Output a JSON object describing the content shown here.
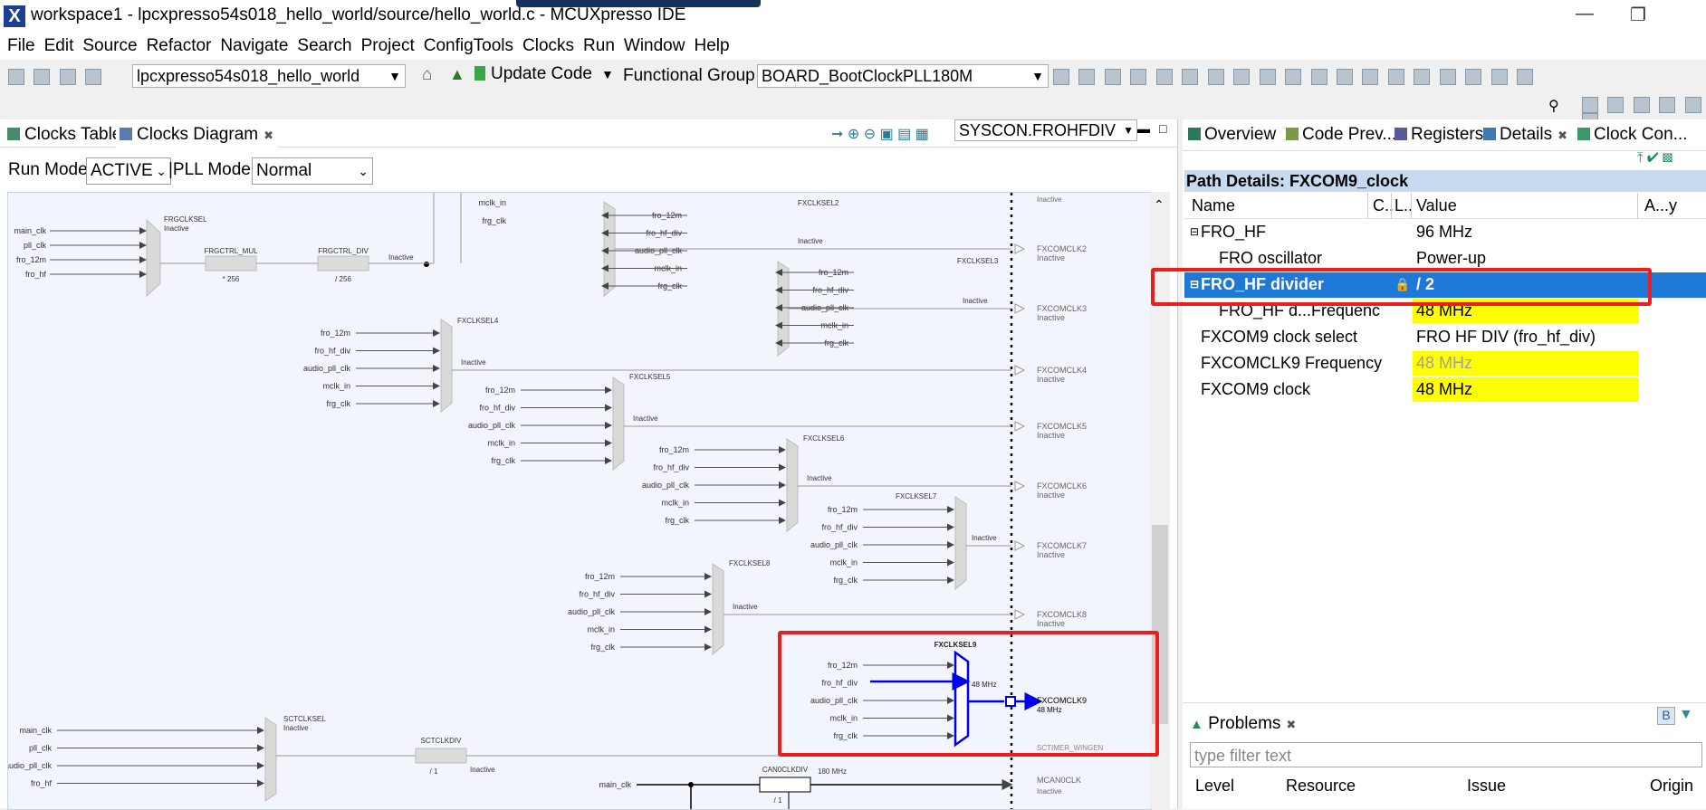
{
  "window": {
    "title": "workspace1 - lpcxpresso54s018_hello_world/source/hello_world.c - MCUXpresso IDE",
    "app_icon": "X"
  },
  "menu": [
    "File",
    "Edit",
    "Source",
    "Refactor",
    "Navigate",
    "Search",
    "Project",
    "ConfigTools",
    "Clocks",
    "Run",
    "Window",
    "Help"
  ],
  "toolbar": {
    "project": "lpcxpresso54s018_hello_world",
    "update_code": "Update Code",
    "functional_group_label": "Functional Group",
    "functional_group_value": "BOARD_BootClockPLL180M"
  },
  "left_tabs": {
    "clocks_table": "Clocks Table",
    "clocks_diagram": "Clocks Diagram",
    "search_value": "SYSCON.FROHFDIV"
  },
  "mode": {
    "run_mode_label": "Run Mode",
    "run_mode_value": "ACTIVE",
    "pll_mode_label": "|PLL Mode",
    "pll_mode_value": "Normal"
  },
  "diagram": {
    "inactive": "Inactive",
    "frgclksel": "FRGCLKSEL",
    "frgctrl_mul": "FRGCTRL_MUL",
    "frgctrl_div": "FRGCTRL_DIV",
    "mul_val": "* 256",
    "div_val": "/ 256",
    "frg_inputs": [
      "main_clk",
      "pll_clk",
      "fro_12m",
      "fro_hf"
    ],
    "fx_inputs": [
      "fro_12m",
      "fro_hf_div",
      "audio_pll_clk",
      "mclk_in",
      "frg_clk"
    ],
    "top_inputs": [
      "mclk_in",
      "frg_clk"
    ],
    "fxclksel": [
      "FXCLKSEL2",
      "FXCLKSEL3",
      "FXCLKSEL4",
      "FXCLKSEL5",
      "FXCLKSEL6",
      "FXCLKSEL7",
      "FXCLKSEL8"
    ],
    "fxcomclk": [
      "FXCOMCLK2",
      "FXCOMCLK3",
      "FXCOMCLK4",
      "FXCOMCLK5",
      "FXCOMCLK6",
      "FXCOMCLK7",
      "FXCOMCLK8"
    ],
    "sel9": "FXCLKSEL9",
    "sel9_freq": "48 MHz",
    "com9": "FXCOMCLK9",
    "com9_freq": "48 MHz",
    "sctclksel": "SCTCLKSEL",
    "sct_inputs": [
      "main_clk",
      "pll_clk",
      "audio_pll_clk",
      "fro_hf"
    ],
    "sctclkdiv": "SCTCLKDIV",
    "sct_div": "/ 1",
    "can0clkdiv": "CAN0CLKDIV",
    "can_freq": "180 MHz",
    "can_div": "/ 1",
    "can_in": "main_clk",
    "mcan0clk": "MCAN0CLK",
    "sctimer": "SCTIMER_WINGEN"
  },
  "right_tabs": [
    "Overview",
    "Code Prev...",
    "Registers",
    "Details",
    "Clock Con..."
  ],
  "details": {
    "path_header": "Path Details: FXCOM9_clock",
    "columns": [
      "Name",
      "C..",
      "L..",
      "Value",
      "A...y"
    ],
    "rows": [
      {
        "name": "FRO_HF",
        "value": "96 MHz",
        "style": "normal",
        "expand": "⊟"
      },
      {
        "name": "FRO oscillator",
        "value": "Power-up",
        "style": "normal",
        "expand": ""
      },
      {
        "name": "FRO_HF divider",
        "value": "/ 2",
        "style": "selected",
        "expand": "⊟"
      },
      {
        "name": "FRO_HF d...Frequenc",
        "value": "48 MHz",
        "style": "yellow",
        "expand": ""
      },
      {
        "name": "FXCOM9 clock select",
        "value": "FRO HF DIV (fro_hf_div)",
        "style": "normal",
        "expand": ""
      },
      {
        "name": "FXCOMCLK9 Frequency",
        "value": "48 MHz",
        "style": "yellow-gray",
        "expand": ""
      },
      {
        "name": "FXCOM9 clock",
        "value": "48 MHz",
        "style": "yellow",
        "expand": ""
      }
    ]
  },
  "problems": {
    "title": "Problems",
    "filter_placeholder": "type filter text",
    "columns": [
      "Level",
      "Resource",
      "Issue",
      "Origin"
    ]
  },
  "colors": {
    "accent": "#1e78d7",
    "highlight": "#ffff00",
    "annotation": "#ee1c1c",
    "active_path": "#0000ee"
  }
}
